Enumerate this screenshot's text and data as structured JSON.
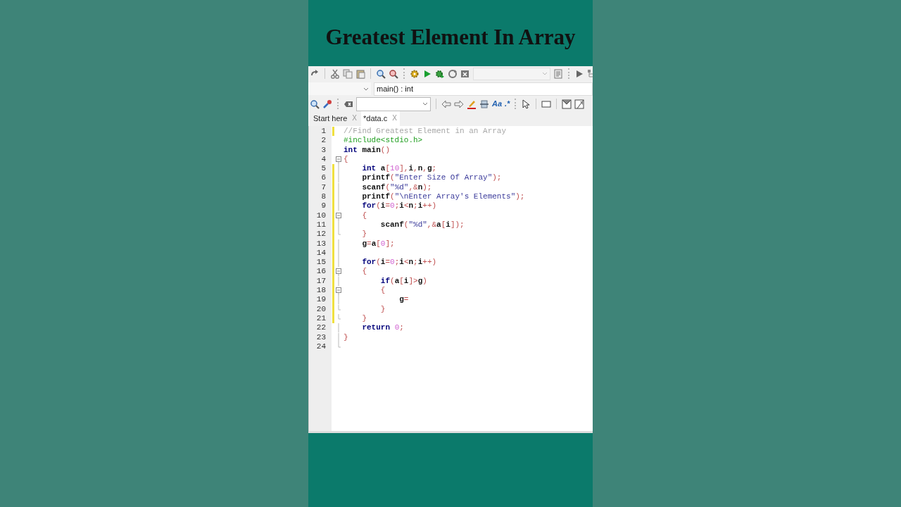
{
  "title": "Greatest Element In Array",
  "toolbar": {
    "function_scope": "main() : int",
    "search_toggles": [
      "Aa",
      ".*"
    ]
  },
  "tabs": [
    {
      "label": "Start here",
      "close": "X",
      "selected": false
    },
    {
      "label": "*data.c",
      "close": "X",
      "selected": true
    }
  ],
  "editor": {
    "lines": [
      {
        "number": "1",
        "modified": true,
        "kind": "plain",
        "tokens": [
          {
            "kind": "comment",
            "text": "//Find Greatest Element in an Array"
          }
        ]
      },
      {
        "number": "2",
        "modified": false,
        "kind": "plain",
        "tokens": [
          {
            "kind": "preproc",
            "text": "#include<stdio.h>"
          }
        ]
      },
      {
        "number": "3",
        "modified": false,
        "kind": "plain",
        "tokens": [
          {
            "kind": "keyword",
            "text": "int "
          },
          {
            "kind": "ident",
            "text": "main"
          },
          {
            "kind": "op",
            "text": "()"
          }
        ]
      },
      {
        "number": "4",
        "modified": false,
        "kind": "open",
        "tokens": [
          {
            "kind": "op",
            "text": "{"
          }
        ]
      },
      {
        "number": "5",
        "modified": true,
        "kind": "body",
        "tokens": [
          {
            "kind": "keyword",
            "text": "    int "
          },
          {
            "kind": "ident",
            "text": "a"
          },
          {
            "kind": "op",
            "text": "["
          },
          {
            "kind": "number",
            "text": "10"
          },
          {
            "kind": "op",
            "text": "],"
          },
          {
            "kind": "ident",
            "text": "i"
          },
          {
            "kind": "op",
            "text": ","
          },
          {
            "kind": "ident",
            "text": "n"
          },
          {
            "kind": "op",
            "text": ","
          },
          {
            "kind": "ident",
            "text": "g"
          },
          {
            "kind": "op",
            "text": ";"
          }
        ]
      },
      {
        "number": "6",
        "modified": true,
        "kind": "body",
        "tokens": [
          {
            "kind": "ident",
            "text": "    printf"
          },
          {
            "kind": "op",
            "text": "("
          },
          {
            "kind": "string",
            "text": "\"Enter Size Of Array\""
          },
          {
            "kind": "op",
            "text": ");"
          }
        ]
      },
      {
        "number": "7",
        "modified": true,
        "kind": "body",
        "tokens": [
          {
            "kind": "ident",
            "text": "    scanf"
          },
          {
            "kind": "op",
            "text": "("
          },
          {
            "kind": "string",
            "text": "\"%d\""
          },
          {
            "kind": "op",
            "text": ",&"
          },
          {
            "kind": "ident",
            "text": "n"
          },
          {
            "kind": "op",
            "text": ");"
          }
        ]
      },
      {
        "number": "8",
        "modified": true,
        "kind": "body",
        "tokens": [
          {
            "kind": "ident",
            "text": "    printf"
          },
          {
            "kind": "op",
            "text": "("
          },
          {
            "kind": "string",
            "text": "\"\\nEnter Array's Elements\""
          },
          {
            "kind": "op",
            "text": ");"
          }
        ]
      },
      {
        "number": "9",
        "modified": true,
        "kind": "body",
        "tokens": [
          {
            "kind": "keyword",
            "text": "    for"
          },
          {
            "kind": "op",
            "text": "("
          },
          {
            "kind": "ident",
            "text": "i"
          },
          {
            "kind": "op",
            "text": "="
          },
          {
            "kind": "number",
            "text": "0"
          },
          {
            "kind": "op",
            "text": ";"
          },
          {
            "kind": "ident",
            "text": "i"
          },
          {
            "kind": "op",
            "text": "<"
          },
          {
            "kind": "ident",
            "text": "n"
          },
          {
            "kind": "op",
            "text": ";"
          },
          {
            "kind": "ident",
            "text": "i"
          },
          {
            "kind": "op",
            "text": "++)"
          }
        ]
      },
      {
        "number": "10",
        "modified": true,
        "kind": "open",
        "tokens": [
          {
            "kind": "op",
            "text": "    {"
          }
        ]
      },
      {
        "number": "11",
        "modified": true,
        "kind": "body",
        "tokens": [
          {
            "kind": "ident",
            "text": "        scanf"
          },
          {
            "kind": "op",
            "text": "("
          },
          {
            "kind": "string",
            "text": "\"%d\""
          },
          {
            "kind": "op",
            "text": ",&"
          },
          {
            "kind": "ident",
            "text": "a"
          },
          {
            "kind": "op",
            "text": "["
          },
          {
            "kind": "ident",
            "text": "i"
          },
          {
            "kind": "op",
            "text": "]);"
          }
        ]
      },
      {
        "number": "12",
        "modified": true,
        "kind": "close",
        "tokens": [
          {
            "kind": "op",
            "text": "    }"
          }
        ]
      },
      {
        "number": "13",
        "modified": true,
        "kind": "body",
        "tokens": [
          {
            "kind": "ident",
            "text": "    g"
          },
          {
            "kind": "op",
            "text": "="
          },
          {
            "kind": "ident",
            "text": "a"
          },
          {
            "kind": "op",
            "text": "["
          },
          {
            "kind": "number",
            "text": "0"
          },
          {
            "kind": "op",
            "text": "];"
          }
        ]
      },
      {
        "number": "14",
        "modified": true,
        "kind": "body"
      },
      {
        "number": "15",
        "modified": true,
        "kind": "body",
        "tokens": [
          {
            "kind": "keyword",
            "text": "    for"
          },
          {
            "kind": "op",
            "text": "("
          },
          {
            "kind": "ident",
            "text": "i"
          },
          {
            "kind": "op",
            "text": "="
          },
          {
            "kind": "number",
            "text": "0"
          },
          {
            "kind": "op",
            "text": ";"
          },
          {
            "kind": "ident",
            "text": "i"
          },
          {
            "kind": "op",
            "text": "<"
          },
          {
            "kind": "ident",
            "text": "n"
          },
          {
            "kind": "op",
            "text": ";"
          },
          {
            "kind": "ident",
            "text": "i"
          },
          {
            "kind": "op",
            "text": "++)"
          }
        ]
      },
      {
        "number": "16",
        "modified": true,
        "kind": "open",
        "tokens": [
          {
            "kind": "op",
            "text": "    {"
          }
        ]
      },
      {
        "number": "17",
        "modified": true,
        "kind": "body",
        "tokens": [
          {
            "kind": "keyword",
            "text": "        if"
          },
          {
            "kind": "op",
            "text": "("
          },
          {
            "kind": "ident",
            "text": "a"
          },
          {
            "kind": "op",
            "text": "["
          },
          {
            "kind": "ident",
            "text": "i"
          },
          {
            "kind": "op",
            "text": "]>"
          },
          {
            "kind": "ident",
            "text": "g"
          },
          {
            "kind": "op",
            "text": ")"
          }
        ]
      },
      {
        "number": "18",
        "modified": true,
        "kind": "open",
        "tokens": [
          {
            "kind": "op",
            "text": "        {"
          }
        ]
      },
      {
        "number": "19",
        "modified": true,
        "kind": "body",
        "tokens": [
          {
            "kind": "ident",
            "text": "            g"
          },
          {
            "kind": "op",
            "text": "="
          }
        ]
      },
      {
        "number": "20",
        "modified": true,
        "kind": "close",
        "tokens": [
          {
            "kind": "op",
            "text": "        }"
          }
        ]
      },
      {
        "number": "21",
        "modified": true,
        "kind": "close",
        "tokens": [
          {
            "kind": "op",
            "text": "    }"
          }
        ]
      },
      {
        "number": "22",
        "modified": false,
        "kind": "body",
        "tokens": [
          {
            "kind": "keyword",
            "text": "    return "
          },
          {
            "kind": "number",
            "text": "0"
          },
          {
            "kind": "op",
            "text": ";"
          }
        ]
      },
      {
        "number": "23",
        "modified": false,
        "kind": "body",
        "tokens": [
          {
            "kind": "op",
            "text": "}"
          }
        ]
      },
      {
        "number": "24",
        "modified": false,
        "kind": "close"
      }
    ]
  }
}
